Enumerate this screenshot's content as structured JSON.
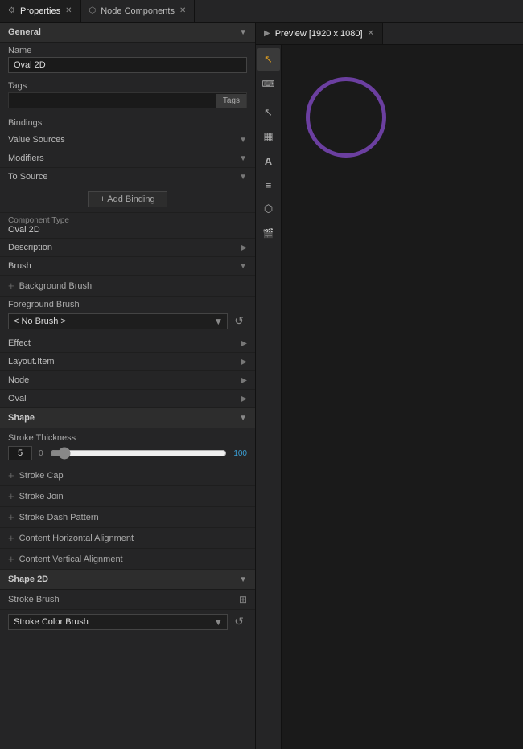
{
  "tabs": {
    "properties": {
      "label": "Properties",
      "icon": "⚙",
      "active": true
    },
    "node_components": {
      "label": "Node Components",
      "icon": "⬡",
      "active": false
    },
    "preview": {
      "label": "Preview [1920 x 1080]",
      "active": true
    }
  },
  "properties_panel": {
    "general_section": "General",
    "name_label": "Name",
    "name_value": "Oval 2D",
    "tags_label": "Tags",
    "tags_btn": "Tags",
    "bindings_label": "Bindings",
    "value_sources_label": "Value Sources",
    "modifiers_label": "Modifiers",
    "to_source_label": "To Source",
    "add_binding_label": "+ Add Binding",
    "component_type_label": "Component Type",
    "component_type_value": "Oval 2D",
    "description_label": "Description",
    "brush_label": "Brush",
    "background_brush_label": "Background Brush",
    "foreground_brush_label": "Foreground Brush",
    "no_brush_label": "< No Brush >",
    "effect_label": "Effect",
    "layout_item_label": "Layout.Item",
    "node_label": "Node",
    "oval_label": "Oval",
    "shape_label": "Shape",
    "stroke_thickness_label": "Stroke Thickness",
    "stroke_value": "5",
    "stroke_min": "0",
    "stroke_max": "100",
    "stroke_cap_label": "Stroke Cap",
    "stroke_join_label": "Stroke Join",
    "stroke_dash_label": "Stroke Dash Pattern",
    "content_h_label": "Content Horizontal Alignment",
    "content_v_label": "Content Vertical Alignment",
    "shape_2d_label": "Shape 2D",
    "stroke_brush_label": "Stroke Brush",
    "stroke_color_brush_label": "Stroke Color Brush"
  },
  "toolbar": {
    "cursor_icon": "↖",
    "keyboard_icon": "⌨",
    "pointer_icon": "↖",
    "grid_icon": "▦",
    "text_icon": "A",
    "layers_icon": "≡",
    "link_icon": "⬡",
    "camera_icon": "🎬"
  },
  "preview": {
    "oval": {
      "border_color": "#6b3fa0",
      "border_width": 5
    }
  }
}
